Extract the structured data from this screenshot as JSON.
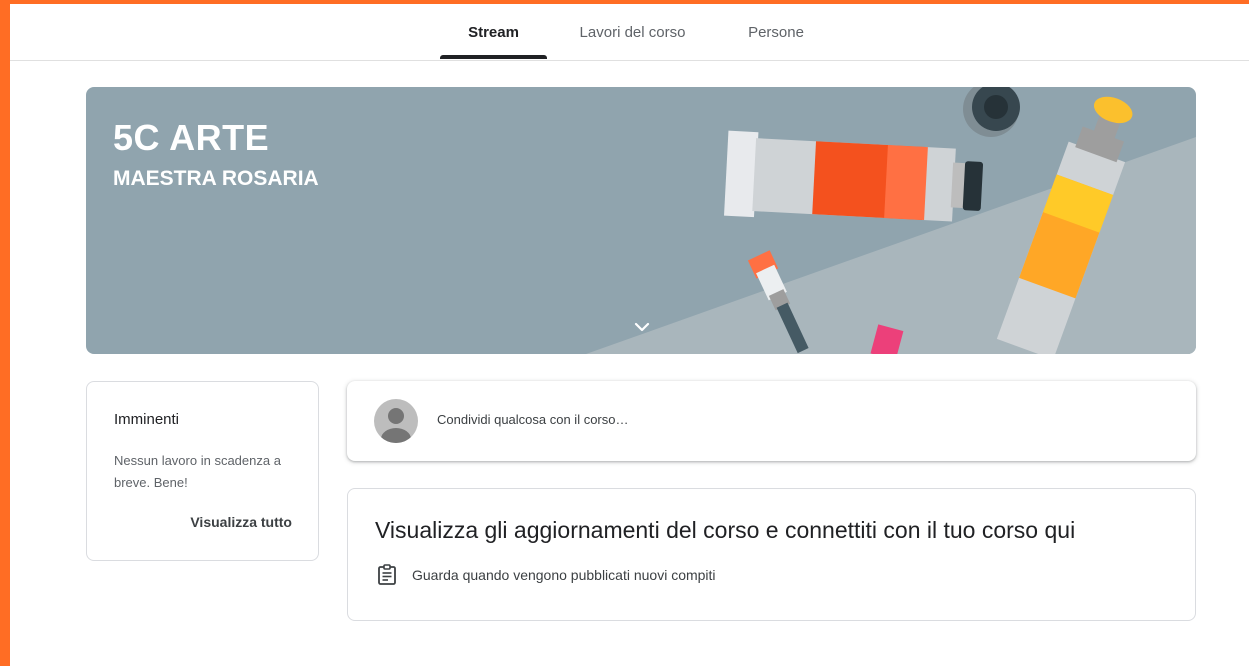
{
  "theme": {
    "frame": "#ff6d24",
    "banner": "#90a4ae"
  },
  "nav": {
    "tabs": [
      {
        "label": "Stream",
        "active": true
      },
      {
        "label": "Lavori del corso",
        "active": false
      },
      {
        "label": "Persone",
        "active": false
      }
    ]
  },
  "banner": {
    "title": "5C ARTE",
    "section": "MAESTRA ROSARIA",
    "expand_icon": "chevron-down-icon"
  },
  "upcoming": {
    "title": "Imminenti",
    "text": "Nessun lavoro in scadenza a breve. Bene!",
    "link": "Visualizza tutto"
  },
  "share": {
    "avatar_icon": "person-avatar-icon",
    "placeholder": "Condividi qualcosa con il corso…"
  },
  "info": {
    "title": "Visualizza gli aggiornamenti del corso e connettiti con il tuo corso qui",
    "item_icon": "assignment-icon",
    "item_text": "Guarda quando vengono pubblicati nuovi compiti"
  }
}
